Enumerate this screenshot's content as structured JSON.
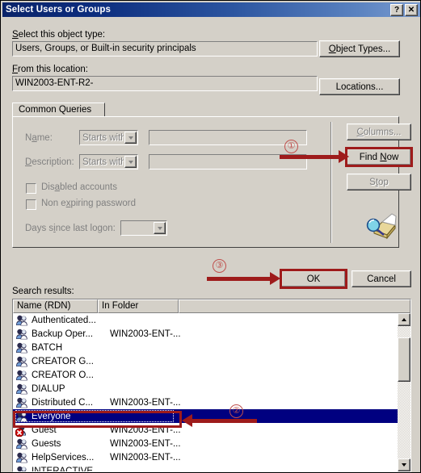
{
  "window": {
    "title": "Select Users or Groups",
    "help_button": "?",
    "close_button": "✕"
  },
  "object_type": {
    "label": "Select this object type:",
    "label_accesskey": "S",
    "value": "Users, Groups, or Built-in security principals",
    "button": "Object Types...",
    "button_accesskey": "O"
  },
  "location": {
    "label": "From this location:",
    "label_accesskey": "F",
    "value": "WIN2003-ENT-R2-",
    "button": "Locations...",
    "button_accesskey": "L"
  },
  "tab": {
    "label": "Common Queries"
  },
  "query": {
    "name_label": "Name:",
    "name_accesskey": "a",
    "name_operator": "Starts with",
    "name_value": "",
    "description_label": "Description:",
    "description_accesskey": "D",
    "description_operator": "Starts with",
    "description_value": "",
    "disabled_accounts_label": "Disabled accounts",
    "disabled_accounts_checked": false,
    "non_expiring_password_label": "Non expiring password",
    "non_expiring_password_checked": false,
    "days_since_logon_label": "Days since last logon:",
    "days_since_logon_value": ""
  },
  "side_buttons": {
    "columns": "Columns...",
    "columns_enabled": false,
    "find_now": "Find Now",
    "find_now_enabled": true,
    "stop": "Stop",
    "stop_enabled": false,
    "search_icon": "search-magnifier-icon"
  },
  "dialog_buttons": {
    "ok": "OK",
    "cancel": "Cancel"
  },
  "results": {
    "label": "Search results:",
    "label_accesskey": "r",
    "columns": [
      "Name (RDN)",
      "In Folder",
      ""
    ],
    "rows": [
      {
        "name": "Authenticated...",
        "folder": "",
        "icon": "group-icon",
        "selected": false
      },
      {
        "name": "Backup Oper...",
        "folder": "WIN2003-ENT-...",
        "icon": "group-icon",
        "selected": false
      },
      {
        "name": "BATCH",
        "folder": "",
        "icon": "group-icon",
        "selected": false
      },
      {
        "name": "CREATOR G...",
        "folder": "",
        "icon": "group-icon",
        "selected": false
      },
      {
        "name": "CREATOR O...",
        "folder": "",
        "icon": "group-icon",
        "selected": false
      },
      {
        "name": "DIALUP",
        "folder": "",
        "icon": "group-icon",
        "selected": false
      },
      {
        "name": "Distributed C...",
        "folder": "WIN2003-ENT-...",
        "icon": "group-icon",
        "selected": false
      },
      {
        "name": "Everyone",
        "folder": "",
        "icon": "group-icon",
        "selected": true
      },
      {
        "name": "Guest",
        "folder": "WIN2003-ENT-...",
        "icon": "disabled-user-icon",
        "selected": false
      },
      {
        "name": "Guests",
        "folder": "WIN2003-ENT-...",
        "icon": "group-icon",
        "selected": false
      },
      {
        "name": "HelpServices...",
        "folder": "WIN2003-ENT-...",
        "icon": "group-icon",
        "selected": false
      },
      {
        "name": "INTERACTIVE",
        "folder": "",
        "icon": "group-icon",
        "selected": false
      }
    ]
  },
  "annotations": [
    {
      "id": "1",
      "label": "①",
      "target": "find-now-button"
    },
    {
      "id": "2",
      "label": "②",
      "target": "everyone-row"
    },
    {
      "id": "3",
      "label": "③",
      "target": "ok-button"
    }
  ],
  "colors": {
    "title_bar_start": "#0a246a",
    "title_bar_end": "#7b9cd0",
    "dialog_face": "#d4d0c8",
    "selection": "#000080",
    "annotation_red": "#9e1b1b",
    "annotation_circle": "#c0504d"
  }
}
